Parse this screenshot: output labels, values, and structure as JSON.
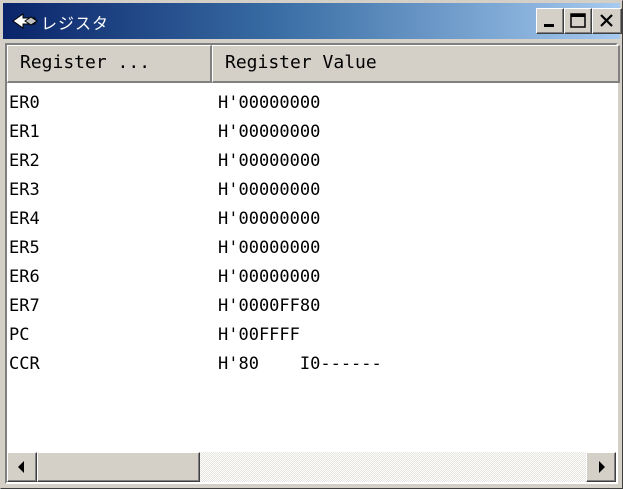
{
  "window": {
    "title": "レジスタ",
    "icon": "diamond-arrow-icon"
  },
  "columns": [
    {
      "label": "Register ..."
    },
    {
      "label": "Register Value"
    }
  ],
  "registers": [
    {
      "name": "ER0",
      "value": "H'00000000"
    },
    {
      "name": "ER1",
      "value": "H'00000000"
    },
    {
      "name": "ER2",
      "value": "H'00000000"
    },
    {
      "name": "ER3",
      "value": "H'00000000"
    },
    {
      "name": "ER4",
      "value": "H'00000000"
    },
    {
      "name": "ER5",
      "value": "H'00000000"
    },
    {
      "name": "ER6",
      "value": "H'00000000"
    },
    {
      "name": "ER7",
      "value": "H'0000FF80"
    },
    {
      "name": "PC",
      "value": "H'00FFFF"
    },
    {
      "name": "CCR",
      "value": "H'80    I0------"
    }
  ],
  "colors": {
    "titlebar_start": "#0a246a",
    "titlebar_end": "#a6caf0",
    "face": "#d4d0c8"
  }
}
